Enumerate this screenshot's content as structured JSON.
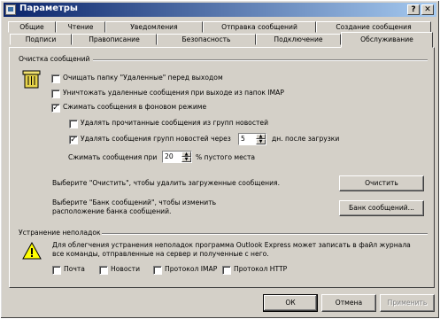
{
  "window": {
    "title": "Параметры",
    "help_button": "?",
    "close_button": "✕"
  },
  "tabs_back": [
    "Общие",
    "Чтение",
    "Уведомления",
    "Отправка сообщений",
    "Создание сообщения"
  ],
  "tabs_front": [
    "Подписи",
    "Правописание",
    "Безопасность",
    "Подключение",
    "Обслуживание"
  ],
  "cleanup": {
    "heading": "Очистка сообщений",
    "empty_deleted": "Очищать папку \"Удаленные\" перед выходом",
    "purge_imap": "Уничтожать удаленные сообщения при выходе из папок IMAP",
    "compress_background": "Сжимать сообщения в фоновом режиме",
    "delete_read": "Удалять прочитанные сообщения из групп новостей",
    "delete_news_prefix": "Удалять сообщения групп новостей через",
    "delete_news_days": "5",
    "delete_news_suffix": "дн. после загрузки",
    "compact_prefix": "Сжимать сообщения при",
    "compact_percent": "20",
    "compact_suffix": "% пустого места",
    "clean_desc": "Выберите \"Очистить\", чтобы удалить загруженные сообщения.",
    "clean_button": "Очистить",
    "store_desc": "Выберите \"Банк сообщений\", чтобы изменить расположение банка сообщений.",
    "store_button": "Банк сообщений..."
  },
  "troubleshoot": {
    "heading": "Устранение неполадок",
    "desc": "Для облегчения устранения неполадок программа Outlook Express может записать в файл журнала все команды, отправленные на сервер и полученные с него.",
    "mail": "Почта",
    "news": "Новости",
    "imap": "Протокол IMAP",
    "http": "Протокол HTTP"
  },
  "footer": {
    "ok": "ОК",
    "cancel": "Отмена",
    "apply": "Применить"
  }
}
